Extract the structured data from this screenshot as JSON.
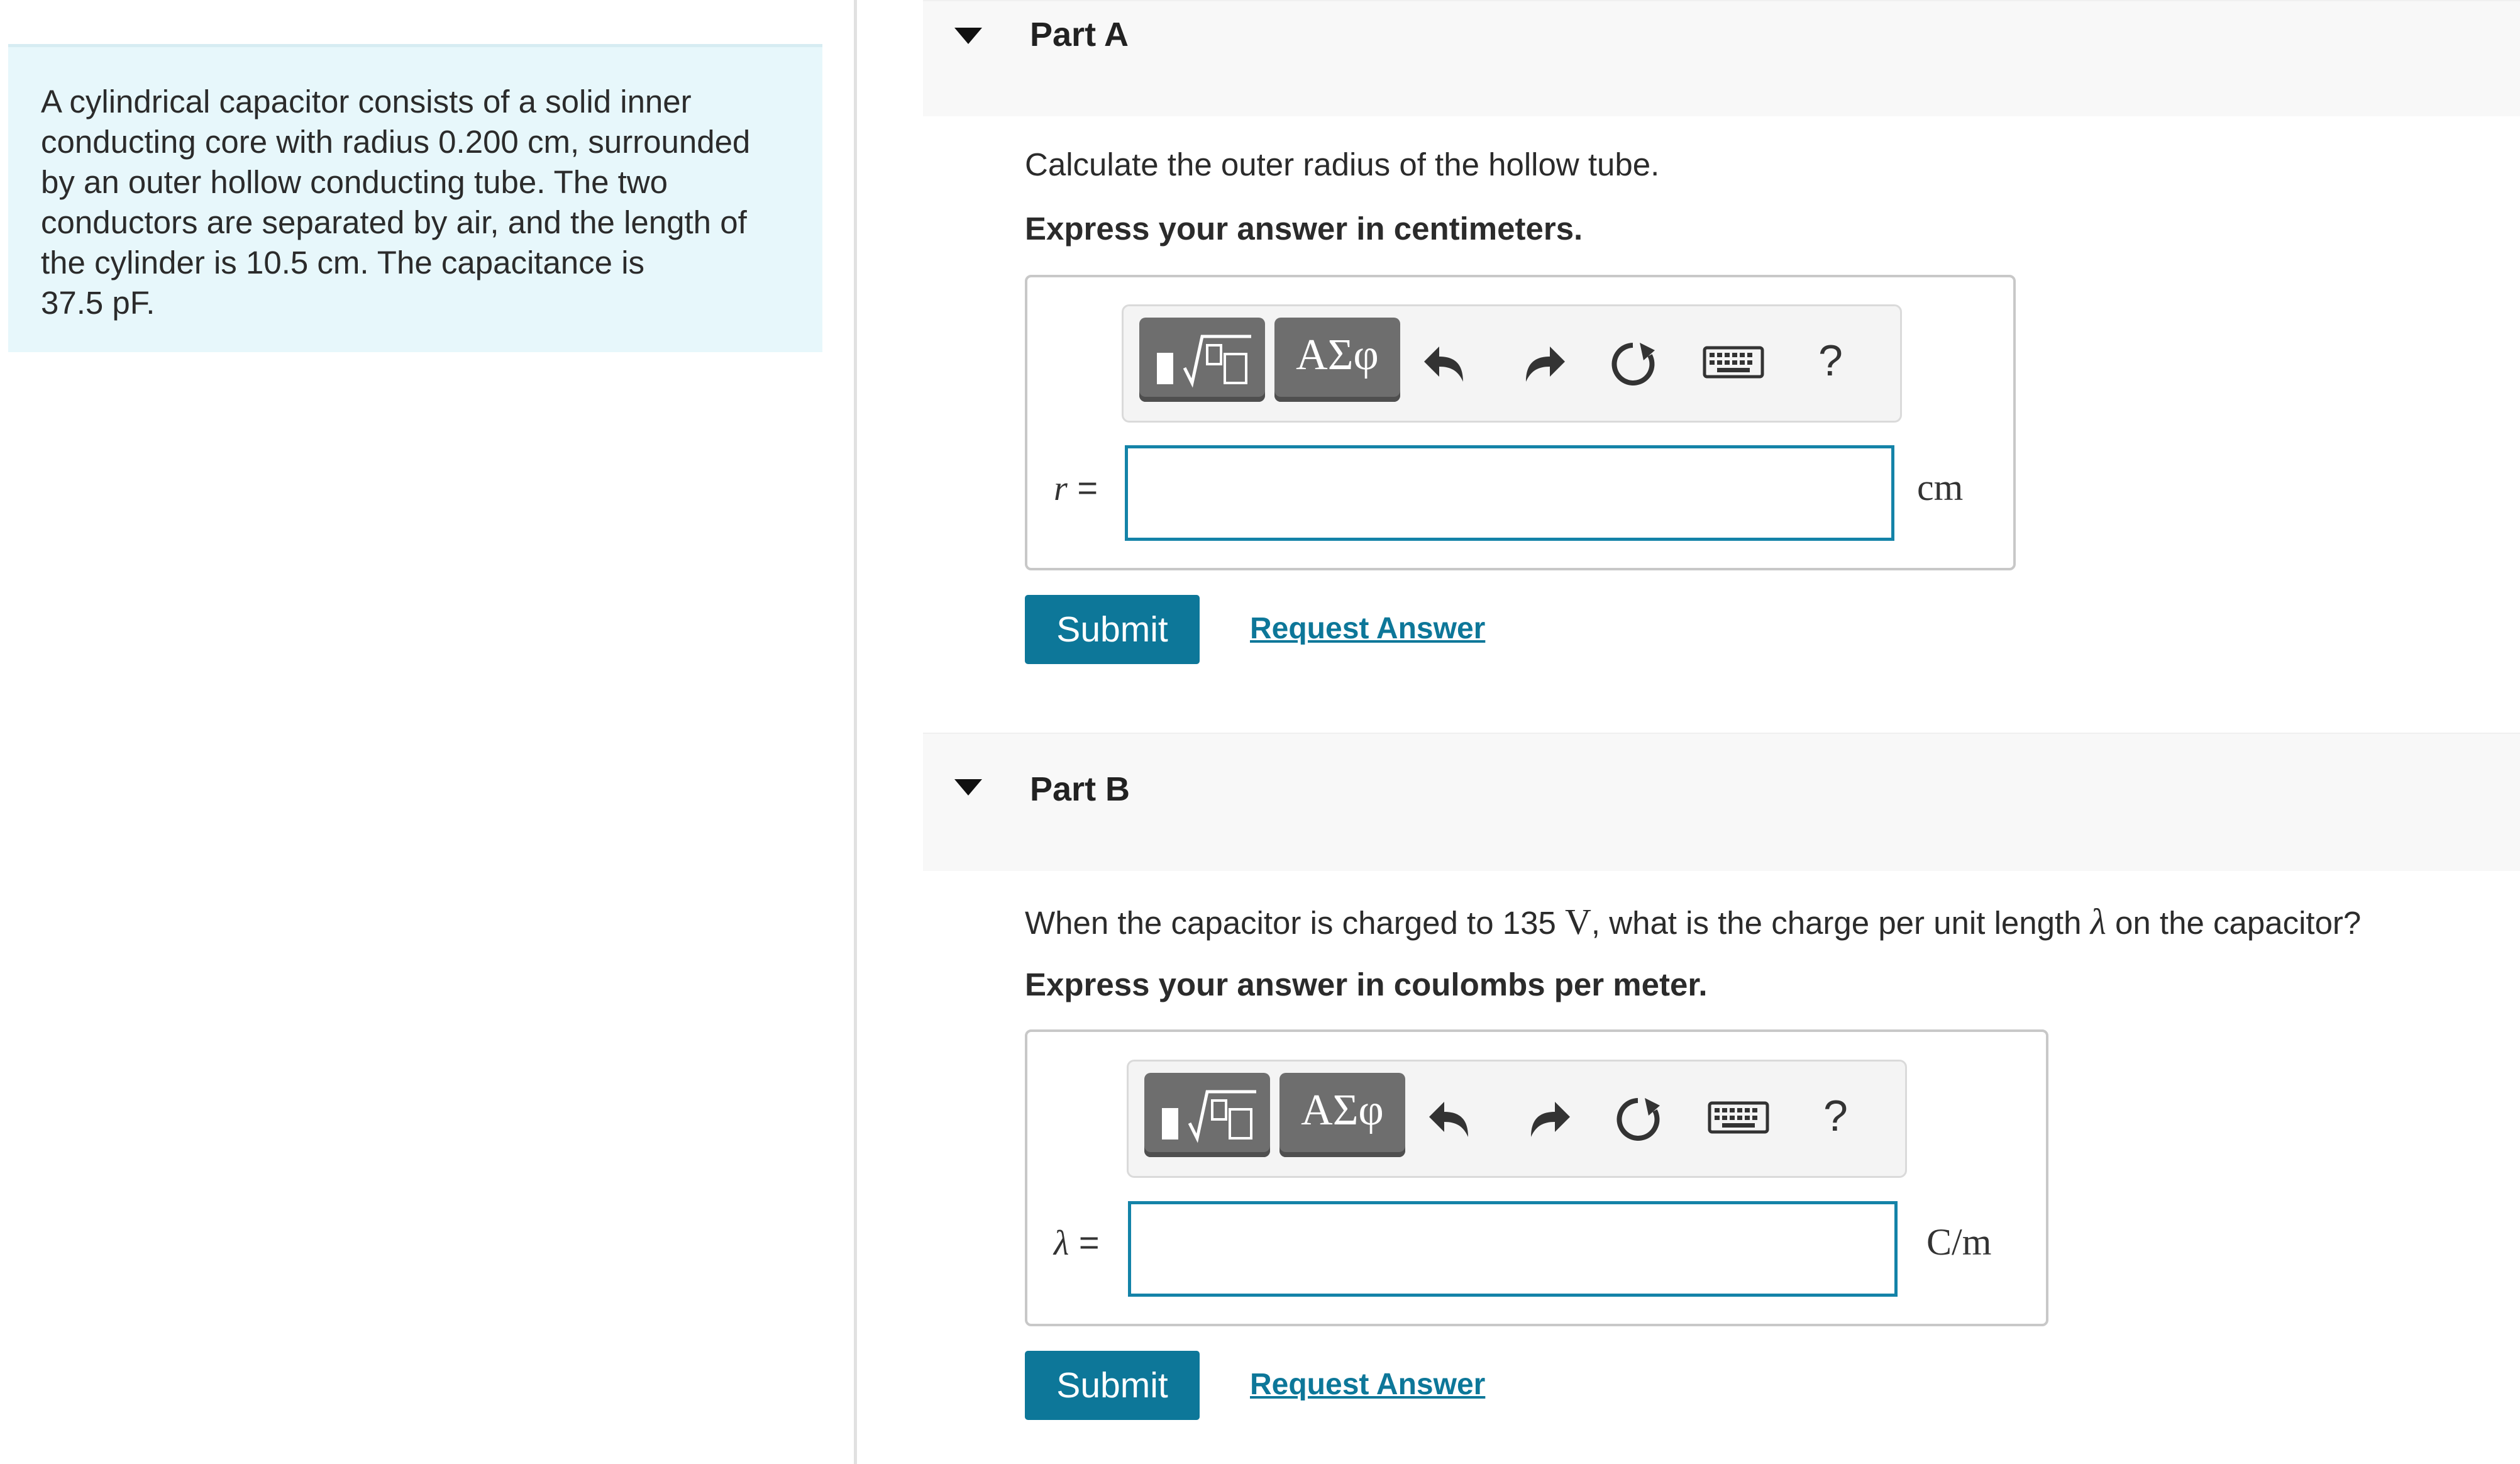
{
  "problem": {
    "lines": [
      "A cylindrical capacitor consists of a solid inner",
      "conducting core with radius 0.200 cm, surrounded",
      "by an outer hollow conducting tube. The two",
      "conductors are separated by air, and the length of",
      "the cylinder is 10.5 cm. The capacitance is",
      "37.5 pF."
    ]
  },
  "toolbar": {
    "templates_icon": "fraction-sqrt-template-icon",
    "greek_label": "ΑΣφ",
    "undo_icon": "undo-icon",
    "redo_icon": "redo-icon",
    "reset_icon": "reset-icon",
    "keyboard_icon": "keyboard-icon",
    "help_label": "?"
  },
  "parts": [
    {
      "title": "Part A",
      "question_pre": "Calculate the outer radius of the hollow tube.",
      "instruction": "Express your answer in centimeters.",
      "variable": "r",
      "equals": "=",
      "input_value": "",
      "unit": "cm",
      "submit_label": "Submit",
      "request_label": "Request Answer"
    },
    {
      "title": "Part B",
      "question_pre": "When the capacitor is charged to 135 ",
      "question_unit": "V",
      "question_mid": ", what is the charge per unit length ",
      "question_symbol": "λ",
      "question_post": " on the capacitor?",
      "instruction": "Express your answer in coulombs per meter.",
      "variable": "λ",
      "equals": "=",
      "input_value": "",
      "unit": "C/m",
      "submit_label": "Submit",
      "request_label": "Request Answer"
    }
  ],
  "colors": {
    "problem_bg": "#e7f7fb",
    "accent": "#0d7799",
    "input_border": "#1483a8",
    "toolbar_button": "#6e6e6e"
  }
}
